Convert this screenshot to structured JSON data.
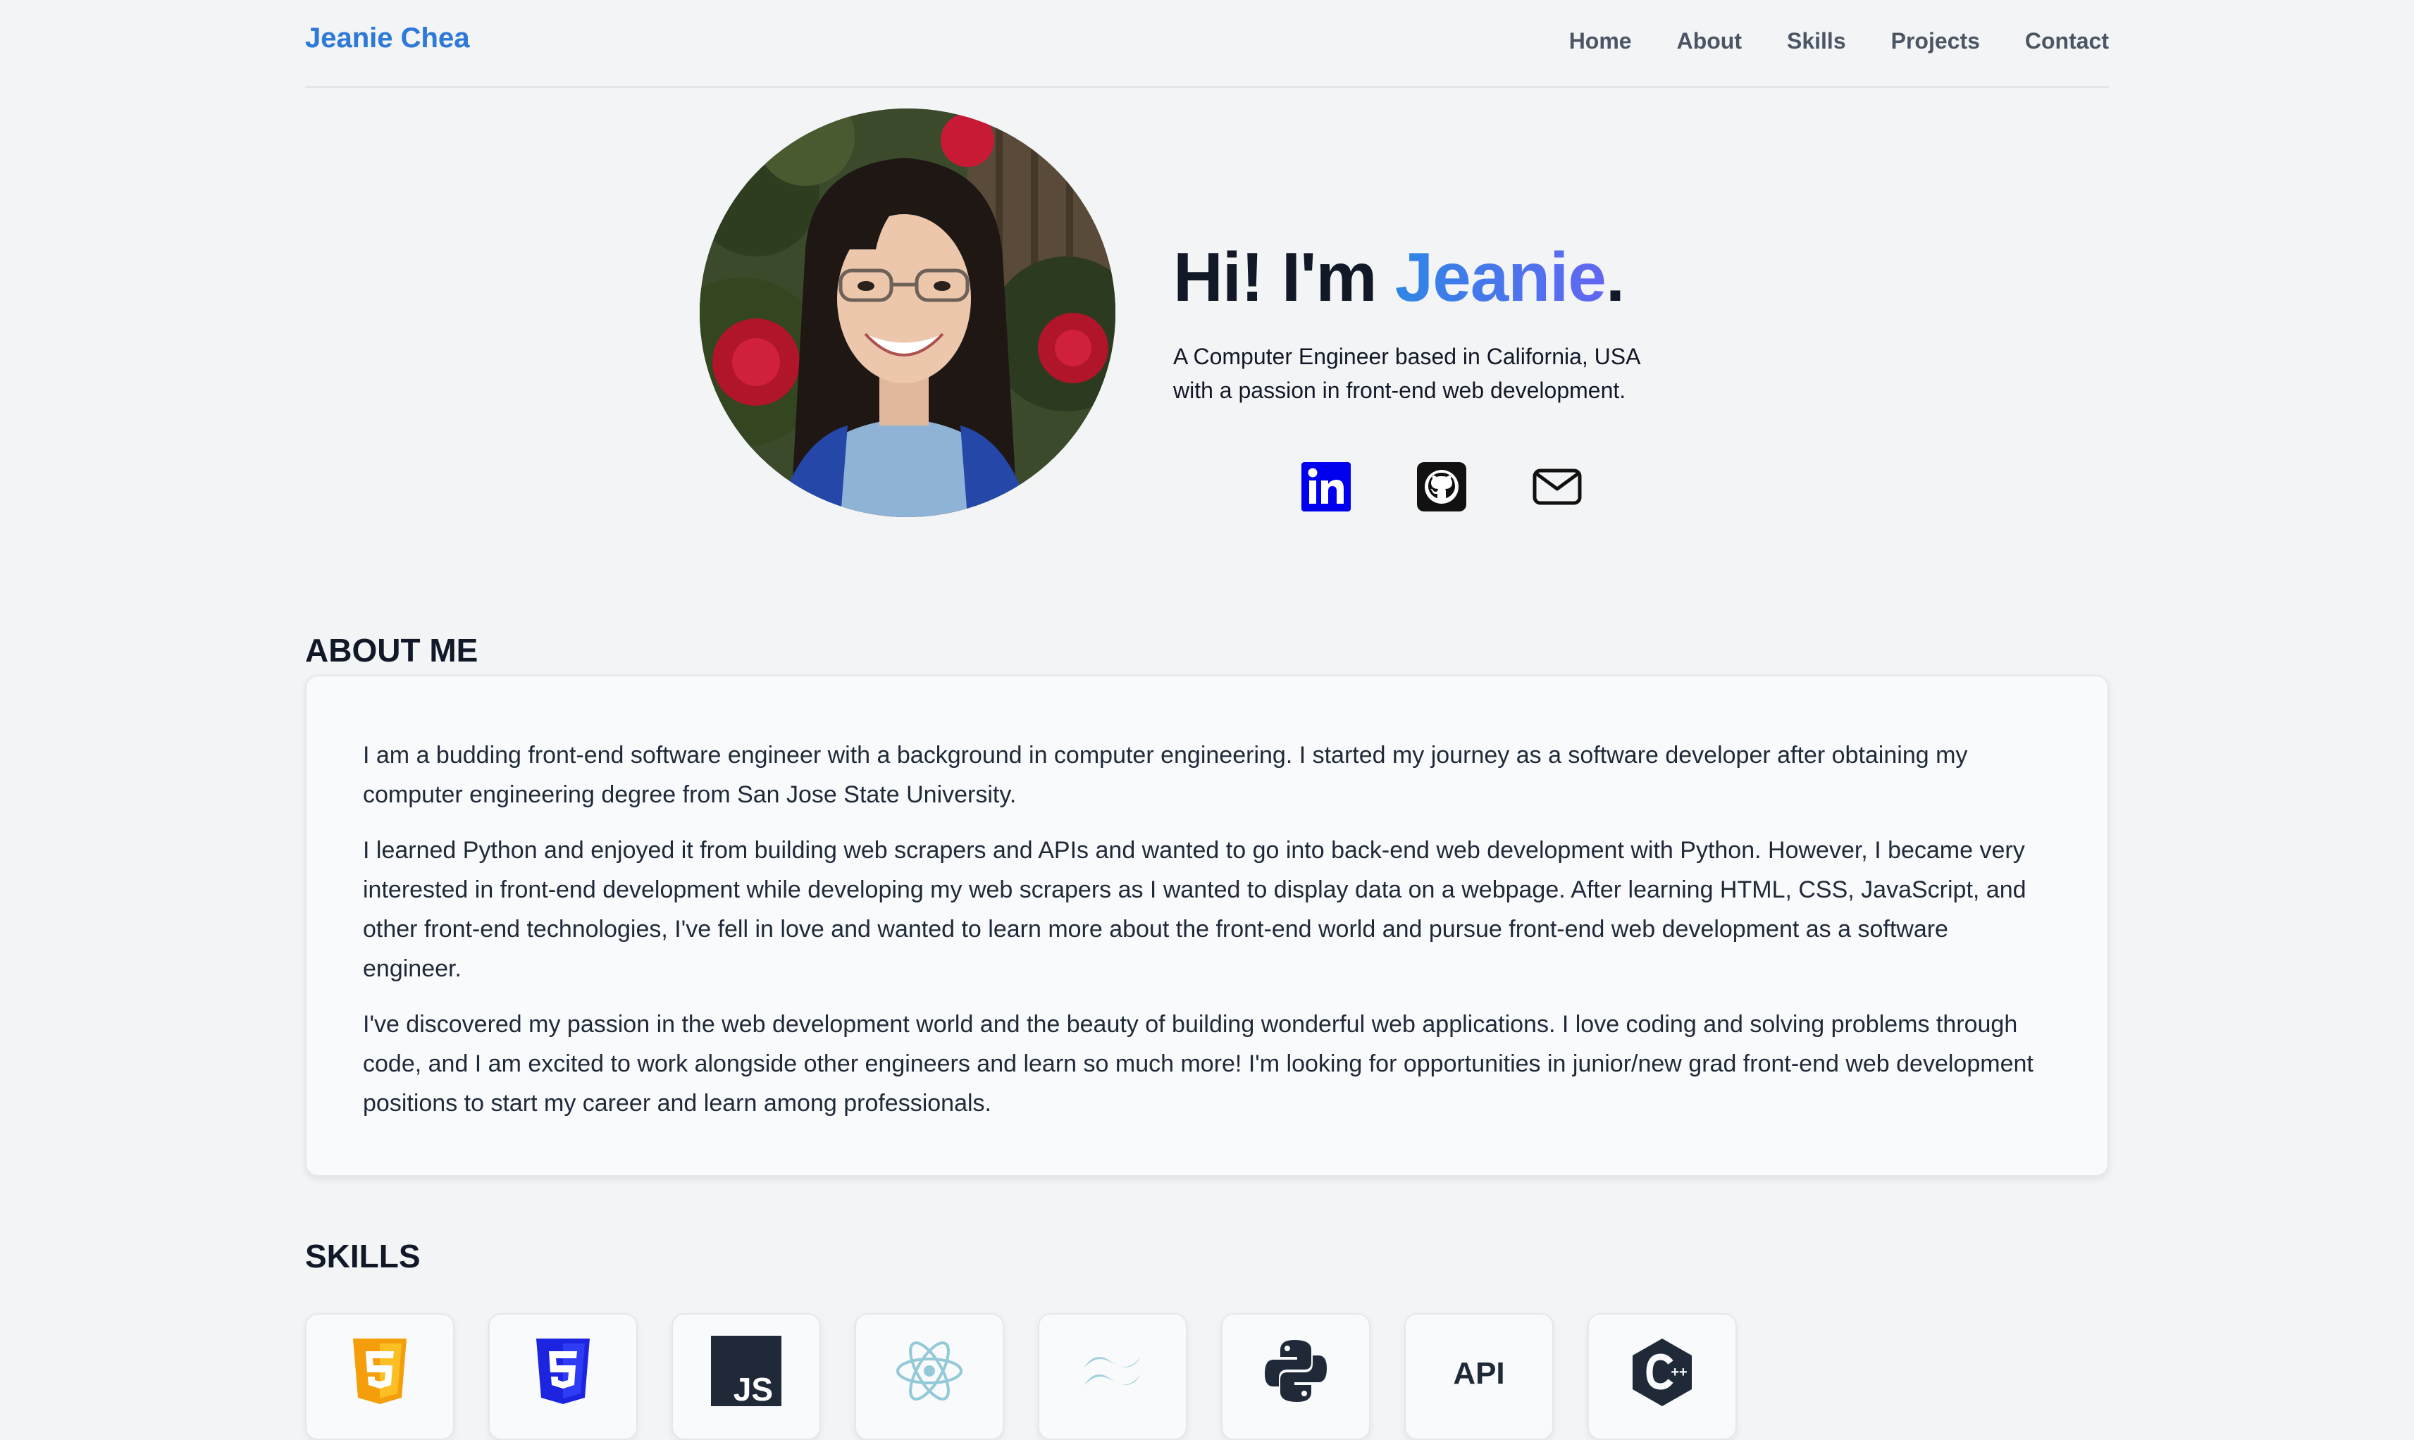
{
  "nav": {
    "brand": "Jeanie Chea",
    "links": [
      "Home",
      "About",
      "Skills",
      "Projects",
      "Contact"
    ]
  },
  "hero": {
    "greeting": "Hi! I'm ",
    "name": "Jeanie",
    "punct": ".",
    "subtitle_line1": "A Computer Engineer based in California, USA",
    "subtitle_line2": "with a passion in front-end web development.",
    "socials": [
      "linkedin-icon",
      "github-icon",
      "mail-icon"
    ]
  },
  "about": {
    "title": "ABOUT ME",
    "paragraphs": [
      "I am a budding front-end software engineer with a background in computer engineering. I started my journey as a software developer after obtaining my computer engineering degree from San Jose State University.",
      "I learned Python and enjoyed it from building web scrapers and APIs and wanted to go into back-end web development with Python. However, I became very interested in front-end development while developing my web scrapers as I wanted to display data on a webpage. After learning HTML, CSS, JavaScript, and other front-end technologies, I've fell in love and wanted to learn more about the front-end world and pursue front-end web development as a software engineer.",
      "I've discovered my passion in the web development world and the beauty of building wonderful web applications. I love coding and solving problems through code, and I am excited to work alongside other engineers and learn so much more! I'm looking for opportunities in junior/new grad front-end web development positions to start my career and learn among professionals."
    ]
  },
  "skills": {
    "title": "SKILLS",
    "items": [
      "html5-icon",
      "css3-icon",
      "javascript-icon",
      "react-icon",
      "tailwind-icon",
      "python-icon",
      "api-icon",
      "cplusplus-icon"
    ],
    "api_label": "API",
    "js_label": "JS"
  },
  "colors": {
    "brand": "#2f7ad6",
    "accent_start": "#2f86e6",
    "accent_end": "#6366f1",
    "linkedin": "#0a66c2"
  }
}
